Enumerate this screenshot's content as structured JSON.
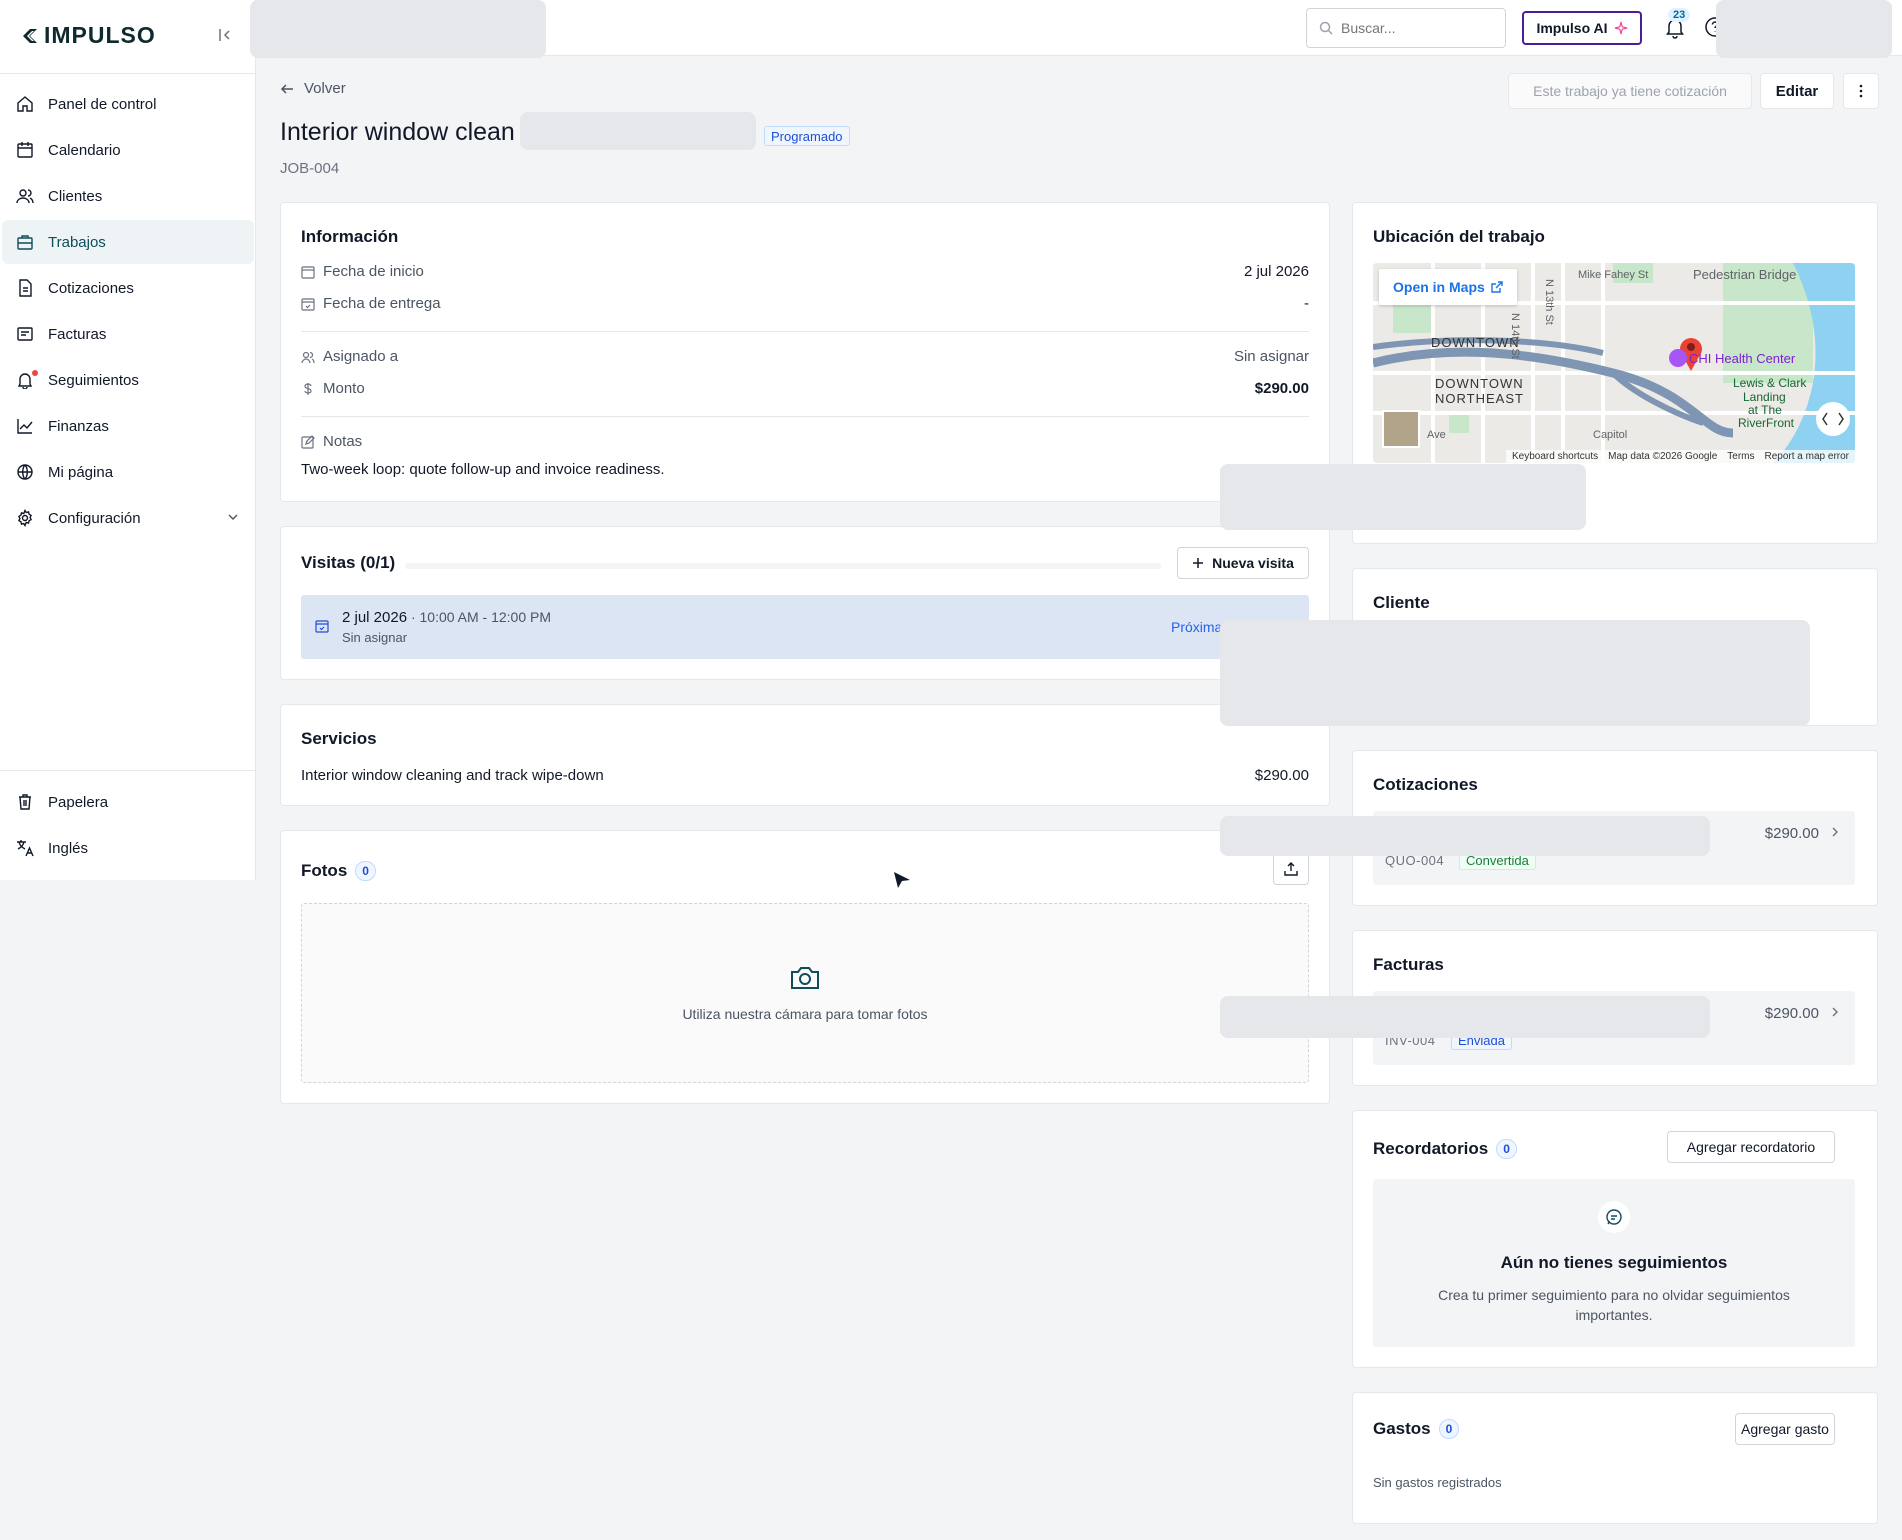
{
  "app": {
    "brand": "IMPULSO"
  },
  "sidebar": {
    "items": [
      {
        "label": "Panel de control",
        "icon": "home-icon"
      },
      {
        "label": "Calendario",
        "icon": "calendar-icon"
      },
      {
        "label": "Clientes",
        "icon": "users-icon"
      },
      {
        "label": "Trabajos",
        "icon": "briefcase-icon",
        "active": true
      },
      {
        "label": "Cotizaciones",
        "icon": "file-icon"
      },
      {
        "label": "Facturas",
        "icon": "receipt-icon"
      },
      {
        "label": "Seguimientos",
        "icon": "bell-icon"
      },
      {
        "label": "Finanzas",
        "icon": "chart-line-icon"
      },
      {
        "label": "Mi página",
        "icon": "globe-icon"
      },
      {
        "label": "Configuración",
        "icon": "gear-icon"
      }
    ],
    "bottom": [
      {
        "label": "Papelera",
        "icon": "trash-icon"
      },
      {
        "label": "Inglés",
        "icon": "translate-icon"
      }
    ]
  },
  "topbar": {
    "search_placeholder": "Buscar...",
    "ai_label": "Impulso AI",
    "notif_count": "23"
  },
  "header": {
    "back_label": "Volver",
    "quote_notice": "Este trabajo ya tiene cotización",
    "edit_label": "Editar",
    "title": "Interior window clean",
    "status": "Programado",
    "job_id": "JOB-004"
  },
  "info": {
    "title": "Información",
    "start_label": "Fecha de inicio",
    "start_value": "2 jul 2026",
    "due_label": "Fecha de entrega",
    "due_value": "-",
    "assigned_label": "Asignado a",
    "assigned_value": "Sin asignar",
    "amount_label": "Monto",
    "amount_value": "$290.00",
    "notes_label": "Notas",
    "notes_value": "Two-week loop: quote follow-up and invoice readiness."
  },
  "visits": {
    "title": "Visitas (0/1)",
    "new_label": "Nueva visita",
    "item": {
      "date": "2 jul 2026",
      "time": " · 10:00 AM - 12:00 PM",
      "assignee": "Sin asignar",
      "status": "Próxima"
    }
  },
  "services": {
    "title": "Servicios",
    "item": {
      "name": "Interior window cleaning and track wipe-down",
      "price": "$290.00"
    }
  },
  "photos": {
    "title": "Fotos",
    "count": "0",
    "hint": "Utiliza nuestra cámara para tomar fotos"
  },
  "location": {
    "title": "Ubicación del trabajo",
    "open_maps": "Open in Maps",
    "labels": {
      "downtown": "DOWNTOWN",
      "downtown_ne_1": "DOWNTOWN",
      "downtown_ne_2": "NORTHEAST",
      "chi": "CHI Health Center",
      "lewis_1": "Lewis & Clark",
      "lewis_2": "Landing",
      "lewis_3": "at The",
      "lewis_4": "RiverFront",
      "mike": "Mike Fahey St",
      "bridge": "Pedestrian Bridge",
      "n14": "N 14th St",
      "n13": "N 13th St",
      "ave": "Ave",
      "cap": "Capitol"
    },
    "footer": [
      "Keyboard shortcuts",
      "Map data ©2026 Google",
      "Terms",
      "Report a map error"
    ]
  },
  "client": {
    "title": "Cliente"
  },
  "quotes": {
    "title": "Cotizaciones",
    "item": {
      "amount": "$290.00",
      "id": "QUO-004",
      "status": "Convertida"
    }
  },
  "invoices": {
    "title": "Facturas",
    "item": {
      "amount": "$290.00",
      "id": "INV-004",
      "status": "Enviada"
    }
  },
  "reminders": {
    "title": "Recordatorios",
    "count": "0",
    "add_label": "Agregar recordatorio",
    "empty_title": "Aún no tienes seguimientos",
    "empty_desc": "Crea tu primer seguimiento para no olvidar seguimientos importantes."
  },
  "expenses": {
    "title": "Gastos",
    "count": "0",
    "add_label": "Agregar gasto",
    "empty": "Sin gastos registrados"
  },
  "colors": {
    "brand": "#0f4c5c",
    "ai_border": "#4c1d95",
    "visit_bg": "#dbe5f3",
    "map_pin": "#ea4335"
  }
}
